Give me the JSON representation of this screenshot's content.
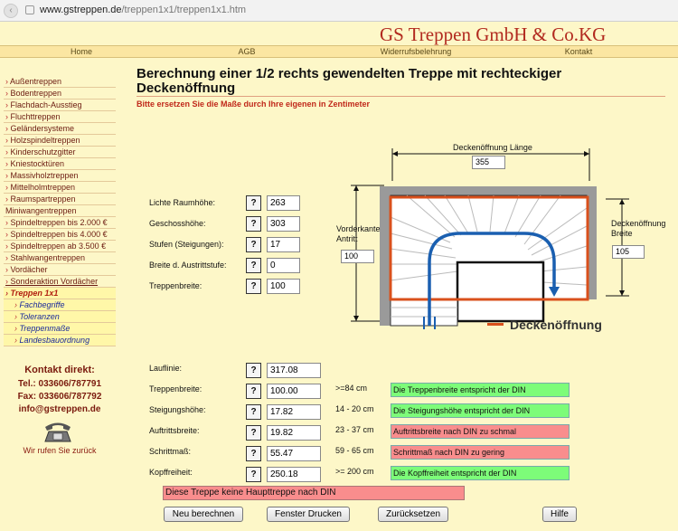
{
  "browser": {
    "url_domain": "www.gstreppen.de",
    "url_path": "/treppen1x1/treppen1x1.htm"
  },
  "brand": "GS Treppen GmbH & Co.KG",
  "topnav": [
    "Home",
    "AGB",
    "Widerrufsbelehrung",
    "Kontakt"
  ],
  "sidebar": {
    "items": [
      "Außentreppen",
      "Bodentreppen",
      "Flachdach-Ausstieg",
      "Fluchttreppen",
      "Geländersysteme",
      "Holzspindeltreppen",
      "Kinderschutzgitter",
      "Kniestocktüren",
      "Massivholztreppen",
      "Mittelholmtreppen",
      "Raumspartreppen"
    ],
    "item_plain": "Miniwangentreppen",
    "items2": [
      "Spindeltreppen bis 2.000 €",
      "Spindeltreppen bis 4.000 €",
      "Spindeltreppen ab  3.500 €",
      "Stahlwangentreppen",
      "Vordächer"
    ],
    "item_underlined": "Sonderaktion Vordächer",
    "selected": "Treppen 1x1",
    "subitems": [
      "Fachbegriffe",
      "Toleranzen",
      "Treppenmaße",
      "Landesbauordnung"
    ]
  },
  "contact": {
    "heading": "Kontakt direkt:",
    "tel": "Tel.: 033606/787791",
    "fax": "Fax: 033606/787792",
    "email": "info@gstreppen.de",
    "callback": "Wir rufen Sie zurück"
  },
  "heading": "Berechnung einer 1/2 rechts gewendelten Treppe mit rechteckiger Deckenöffnung",
  "subheading": "Bitte ersetzen Sie die Maße durch Ihre eigenen in Zentimeter",
  "help_label": "?",
  "inputs": [
    {
      "label": "Lichte Raumhöhe:",
      "value": "263"
    },
    {
      "label": "Geschosshöhe:",
      "value": "303"
    },
    {
      "label": "Stufen (Steigungen):",
      "value": "17"
    },
    {
      "label": "Breite d. Austrittstufe:",
      "value": "0"
    },
    {
      "label": "Treppenbreite:",
      "value": "100"
    }
  ],
  "diagram": {
    "len_label": "Deckenöffnung Länge",
    "len_value": "355",
    "front_label1": "Vorderkante",
    "front_label2": "Antritt",
    "front_value": "100",
    "width_label1": "Deckenöffnung",
    "width_label2": "Breite",
    "width_value": "105",
    "legend": "Deckenöffnung",
    "colors": {
      "opening": "#d9501c",
      "walkline": "#1a5fb0",
      "wall": "#9a9a9a"
    }
  },
  "results": [
    {
      "label": "Lauflinie:",
      "value": "317.08",
      "range": "",
      "msg": "",
      "status": "none"
    },
    {
      "label": "Treppenbreite:",
      "value": "100.00",
      "range": ">=84 cm",
      "msg": "Die Treppenbreite entspricht der DIN",
      "status": "ok"
    },
    {
      "label": "Steigungshöhe:",
      "value": "17.82",
      "range": "14 - 20 cm",
      "msg": "Die Steigungshöhe entspricht der DIN",
      "status": "ok"
    },
    {
      "label": "Auftrittsbreite:",
      "value": "19.82",
      "range": "23 - 37 cm",
      "msg": "Auftrittsbreite nach DIN zu schmal",
      "status": "bad"
    },
    {
      "label": "Schrittmaß:",
      "value": "55.47",
      "range": "59 - 65 cm",
      "msg": "Schrittmaß nach DIN zu gering",
      "status": "bad"
    },
    {
      "label": "Kopffreiheit:",
      "value": "250.18",
      "range": ">= 200 cm",
      "msg": "Die Kopffreiheit entspricht der DIN",
      "status": "ok"
    }
  ],
  "note": "Diese Treppe keine Haupttreppe nach DIN",
  "buttons": [
    "Neu berechnen",
    "Fenster Drucken",
    "Zurücksetzen",
    "Hilfe"
  ]
}
